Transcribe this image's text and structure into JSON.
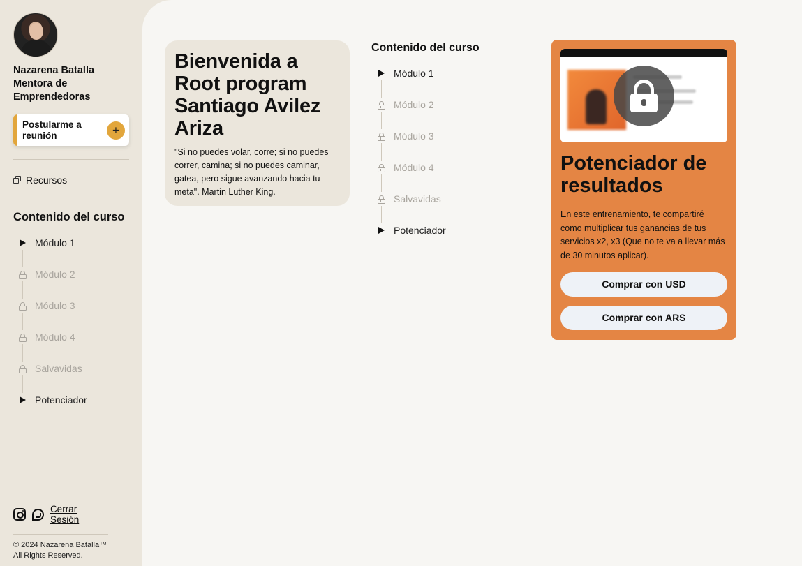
{
  "profile": {
    "name": "Nazarena Batalla Mentora de Emprendedoras"
  },
  "apply": {
    "label": "Postularme a reunión",
    "icon": "+"
  },
  "resources": {
    "label": "Recursos"
  },
  "sidebar_course": {
    "title": "Contenido del curso",
    "modules": [
      {
        "label": "Módulo 1",
        "state": "open"
      },
      {
        "label": "Módulo 2",
        "state": "locked"
      },
      {
        "label": "Módulo 3",
        "state": "locked"
      },
      {
        "label": "Módulo 4",
        "state": "locked"
      },
      {
        "label": "Salvavidas",
        "state": "locked"
      },
      {
        "label": "Potenciador",
        "state": "open"
      }
    ]
  },
  "footer": {
    "logout": "Cerrar Sesión",
    "copyright_line1": "© 2024 Nazarena Batalla™",
    "copyright_line2": "All Rights Reserved."
  },
  "welcome": {
    "title": "Bienvenida a Root program Santiago Avilez Ariza",
    "quote": "\"Si no puedes volar, corre; si no puedes correr, camina; si no puedes caminar, gatea, pero sigue avanzando hacia tu meta\". Martin Luther King."
  },
  "main_course": {
    "title": "Contenido del curso",
    "modules": [
      {
        "label": "Módulo 1",
        "state": "open"
      },
      {
        "label": "Módulo 2",
        "state": "locked"
      },
      {
        "label": "Módulo 3",
        "state": "locked"
      },
      {
        "label": "Módulo 4",
        "state": "locked"
      },
      {
        "label": "Salvavidas",
        "state": "locked"
      },
      {
        "label": "Potenciador",
        "state": "open"
      }
    ]
  },
  "promo": {
    "title": "Potenciador de resultados",
    "description": "En este entrenamiento, te compartiré como multiplicar tus ganancias de tus servicios x2, x3 (Que no te va a llevar más de 30 minutos aplicar).",
    "buy_usd": "Comprar con USD",
    "buy_ars": "Comprar con ARS"
  },
  "colors": {
    "sidebar_bg": "#ebe6dc",
    "main_bg": "#f7f6f3",
    "accent": "#e2a63c",
    "promo_bg": "#e48544",
    "locked_text": "#a9a59e"
  }
}
